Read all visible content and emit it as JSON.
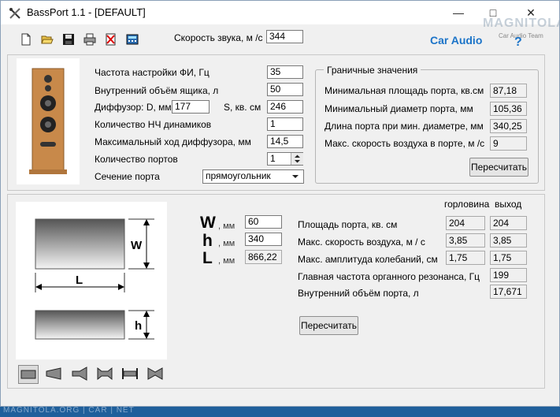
{
  "window": {
    "title": "BassPort 1.1 - [DEFAULT]",
    "brand": "Car Audio",
    "help_mark": "?",
    "logo_text": "MAGNITOLA",
    "logo_sub": "Car Audio Team"
  },
  "toolbar": {
    "sound_speed_label": "Скорость звука, м /с",
    "sound_speed_value": "344"
  },
  "params": {
    "tuning_freq_label": "Частота настройки ФИ, Гц",
    "tuning_freq_value": "35",
    "box_volume_label": "Внутренний объём ящика, л",
    "box_volume_value": "50",
    "diffuser_label": "Диффузор: D, мм",
    "diffuser_d_value": "177",
    "diffuser_s_label": "S, кв. см",
    "diffuser_s_value": "246",
    "driver_count_label": "Количество НЧ динамиков",
    "driver_count_value": "1",
    "max_excursion_label": "Максимальный ход диффузора, мм",
    "max_excursion_value": "14,5",
    "port_count_label": "Количество портов",
    "port_count_value": "1",
    "port_section_label": "Сечение порта",
    "port_section_value": "прямоугольник"
  },
  "limits": {
    "title": "Граничные значения",
    "min_area_label": "Минимальная площадь порта, кв.см",
    "min_area_value": "87,18",
    "min_diameter_label": "Минимальный диаметр порта, мм",
    "min_diameter_value": "105,36",
    "port_length_label": "Длина порта при мин. диаметре, мм",
    "port_length_value": "340,25",
    "max_air_speed_label": "Макс. скорость воздуха в порте, м /с",
    "max_air_speed_value": "9",
    "recalc_label": "Пересчитать"
  },
  "port": {
    "diagram_w": "W",
    "diagram_l": "L",
    "diagram_h": "h",
    "w_letter": "W",
    "h_letter": "h",
    "l_letter": "L",
    "unit_mm": ", мм",
    "w_value": "60",
    "h_value": "340",
    "l_value": "866,22",
    "col_throat": "горловина",
    "col_exit": "выход",
    "area_label": "Площадь порта, кв. см",
    "area_throat": "204",
    "area_exit": "204",
    "speed_label": "Макс. скорость воздуха, м / с",
    "speed_throat": "3,85",
    "speed_exit": "3,85",
    "amplitude_label": "Макс. амплитуда колебаний, см",
    "amplitude_throat": "1,75",
    "amplitude_exit": "1,75",
    "organ_freq_label": "Главная частота органного резонанса, Гц",
    "organ_freq_value": "199",
    "port_volume_label": "Внутренний объём порта, л",
    "port_volume_value": "17,671",
    "recalc_label": "Пересчитать"
  },
  "footer_text": "MAGNITOLA.ORG | CAR | NET",
  "colors": {
    "brand": "#1c74c8",
    "desktop": "#1f5f9b",
    "speaker_wood": "#c8894a"
  }
}
